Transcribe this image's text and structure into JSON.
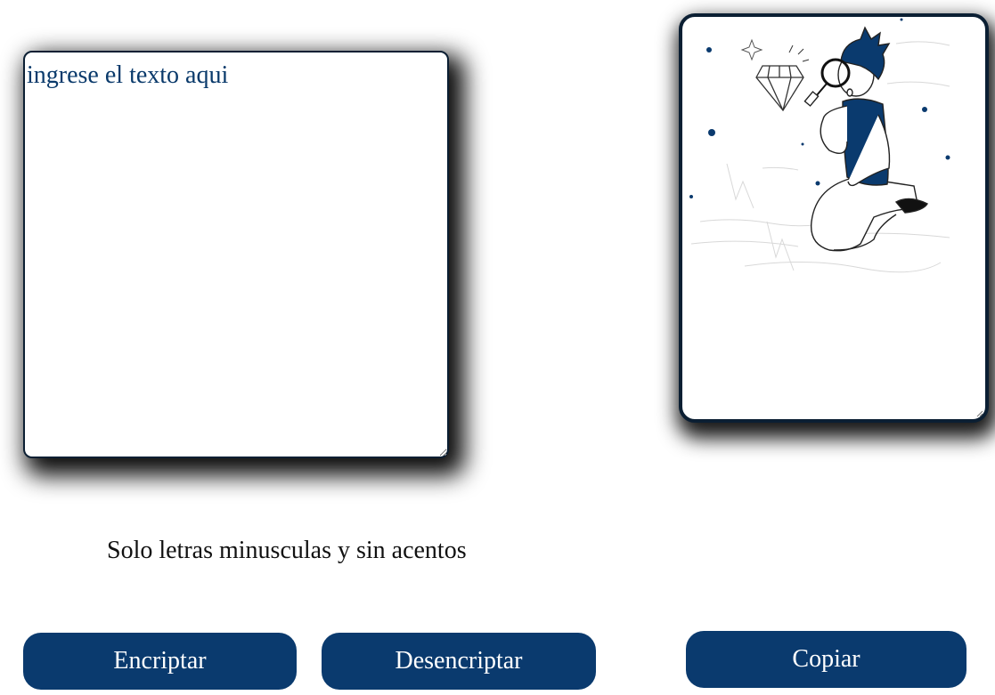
{
  "input": {
    "placeholder": "ingrese el texto aqui",
    "value": ""
  },
  "output": {
    "illustration": "person-with-magnifying-glass-and-diamond",
    "value": ""
  },
  "hint": {
    "text": "Solo letras minusculas y sin acentos"
  },
  "buttons": {
    "encrypt_label": "Encriptar",
    "decrypt_label": "Desencriptar",
    "copy_label": "Copiar"
  },
  "colors": {
    "primary": "#0a3a6e",
    "border": "#0b1f33",
    "text_accent": "#0a3a6b"
  }
}
